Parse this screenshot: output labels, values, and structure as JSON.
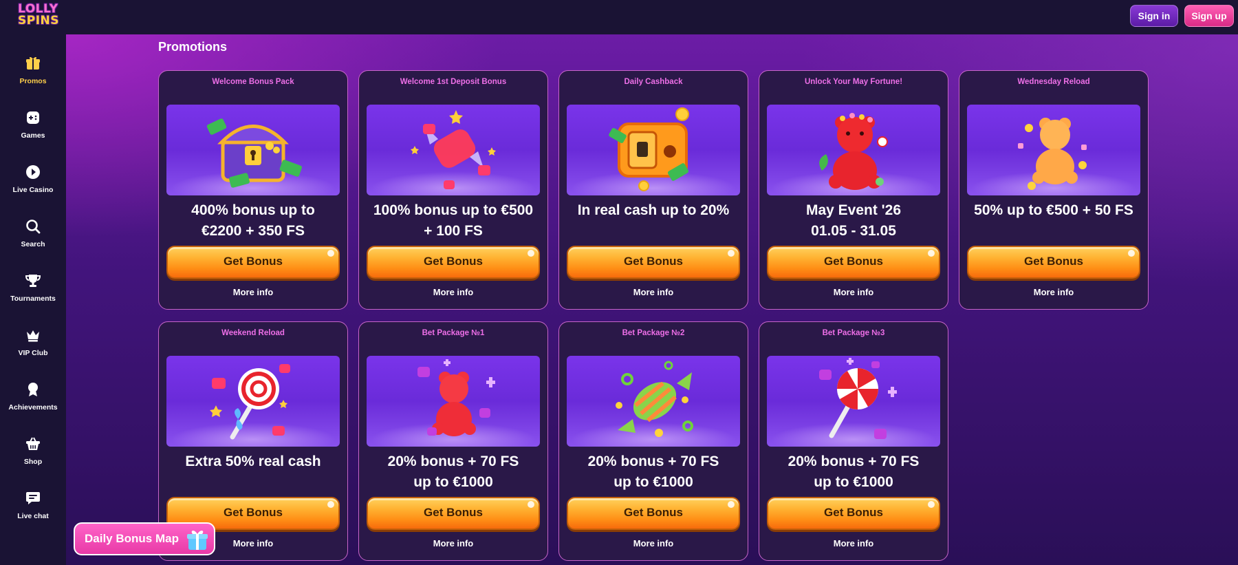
{
  "header": {
    "logo_top": "LOLLY",
    "logo_bottom": "SPINS",
    "signin_label": "Sign in",
    "signup_label": "Sign up"
  },
  "sidebar": {
    "items": [
      {
        "label": "Promos",
        "icon": "gift-icon",
        "active": true
      },
      {
        "label": "Games",
        "icon": "gamepad-icon"
      },
      {
        "label": "Live Casino",
        "icon": "play-icon"
      },
      {
        "label": "Search",
        "icon": "search-icon"
      },
      {
        "label": "Tournaments",
        "icon": "trophy-icon"
      },
      {
        "label": "VIP Club",
        "icon": "crown-icon"
      },
      {
        "label": "Achievements",
        "icon": "medal-icon"
      },
      {
        "label": "Shop",
        "icon": "basket-icon"
      },
      {
        "label": "Live chat",
        "icon": "chat-icon"
      }
    ]
  },
  "main": {
    "title": "Promotions",
    "cards": [
      {
        "title": "Welcome Bonus Pack",
        "line1": "400% bonus up to",
        "line2": "€2200 + 350 FS",
        "button": "Get Bonus",
        "more": "More info",
        "art": "treasure-chest"
      },
      {
        "title": "Welcome 1st Deposit Bonus",
        "line1": "100% bonus up to €500",
        "line2": "+ 100 FS",
        "button": "Get Bonus",
        "more": "More info",
        "art": "candy"
      },
      {
        "title": "Daily Cashback",
        "line1": "In real cash up to 20%",
        "line2": "",
        "button": "Get Bonus",
        "more": "More info",
        "art": "safe"
      },
      {
        "title": "Unlock Your May Fortune!",
        "line1": "May Event '26",
        "line2": "01.05 - 31.05",
        "button": "Get Bonus",
        "more": "More info",
        "art": "red-gummy-bear"
      },
      {
        "title": "Wednesday Reload",
        "line1": "50% up to €500 + 50 FS",
        "line2": "",
        "button": "Get Bonus",
        "more": "More info",
        "art": "orange-gummy-bear"
      },
      {
        "title": "Weekend Reload",
        "line1": "Extra 50% real cash",
        "line2": "",
        "button": "Get Bonus",
        "more": "More info",
        "art": "lollipop"
      },
      {
        "title": "Bet Package №1",
        "line1": "20% bonus + 70 FS",
        "line2": "up to €1000",
        "button": "Get Bonus",
        "more": "More info",
        "art": "red-gummy"
      },
      {
        "title": "Bet Package №2",
        "line1": "20% bonus + 70 FS",
        "line2": "up to €1000",
        "button": "Get Bonus",
        "more": "More info",
        "art": "striped-candy"
      },
      {
        "title": "Bet Package №3",
        "line1": "20% bonus + 70 FS",
        "line2": "up to €1000",
        "button": "Get Bonus",
        "more": "More info",
        "art": "lollipop-2"
      }
    ]
  },
  "floating": {
    "daily_bonus_map": "Daily Bonus Map"
  },
  "colors": {
    "accent_pink": "#ee6fe8",
    "button_orange": "#ff9d1f",
    "card_bg": "#2a1848",
    "active_nav": "#ffcf4a"
  }
}
